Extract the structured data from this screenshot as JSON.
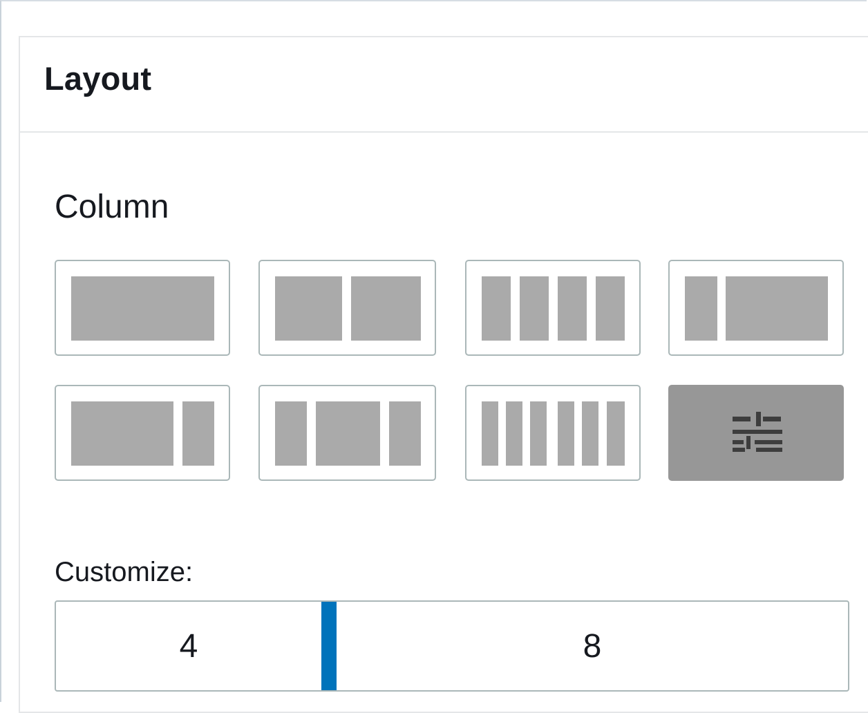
{
  "panel": {
    "title": "Layout"
  },
  "column_section": {
    "label": "Column",
    "presets": [
      {
        "name": "1 column"
      },
      {
        "name": "2 equal columns"
      },
      {
        "name": "4 equal columns"
      },
      {
        "name": "narrow-wide columns"
      },
      {
        "name": "wide-narrow columns"
      },
      {
        "name": "narrow-wide-narrow columns"
      },
      {
        "name": "6 equal columns"
      },
      {
        "name": "custom",
        "icon": "sliders-icon",
        "selected": true
      }
    ]
  },
  "customize": {
    "label": "Customize:",
    "left_value": "4",
    "right_value": "8"
  },
  "colors": {
    "accent": "#0073bb",
    "block": "#aaaaaa",
    "selected_tile": "#979797",
    "border": "#aab7b8"
  }
}
